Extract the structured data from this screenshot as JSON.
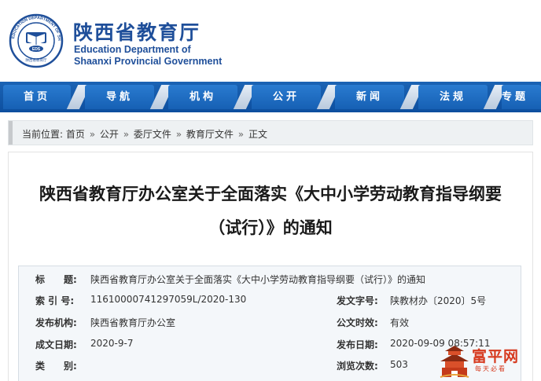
{
  "header": {
    "title_cn": "陕西省教育厅",
    "title_en_line1": "Education Department of",
    "title_en_line2": "Shaanxi Provincial Government",
    "emblem_ring_text": "EDUCATION DEPARTMENT OF SHAANXI",
    "emblem_center": "EDS",
    "emblem_bottom": "陕西省教育厅"
  },
  "nav": {
    "items": [
      "首页",
      "导航",
      "机构",
      "公开",
      "新闻",
      "法规",
      "专题"
    ]
  },
  "breadcrumb": {
    "prefix": "当前位置:",
    "items": [
      "首页",
      "公开",
      "委厅文件",
      "教育厅文件",
      "正文"
    ],
    "separator": "»"
  },
  "article": {
    "title_line1": "陕西省教育厅办公室关于全面落实《大中小学劳动教育指导纲要",
    "title_line2": "（试行）》的通知"
  },
  "info": {
    "subject_label": "标　　题:",
    "subject_value": "陕西省教育厅办公室关于全面落实《大中小学劳动教育指导纲要（试行）》的通知",
    "index_label": "索 引 号:",
    "index_value": "11610000741297059L/2020-130",
    "docno_label": "发文字号:",
    "docno_value": "陕教材办〔2020〕5号",
    "issuer_label": "发布机构:",
    "issuer_value": "陕西省教育厅办公室",
    "validity_label": "公文时效:",
    "validity_value": "有效",
    "created_label": "成文日期:",
    "created_value": "2020-9-7",
    "published_label": "发布日期:",
    "published_value": "2020-09-09 08:57:11",
    "category_label": "类　　别:",
    "category_value": "",
    "views_label": "浏览次数:",
    "views_value": "503"
  },
  "watermark": {
    "brand": "富平网",
    "sub": "每天必看"
  },
  "colors": {
    "brand_blue": "#1f4f9a",
    "nav_blue": "#1660b4",
    "watermark_red": "#d63a1f"
  }
}
